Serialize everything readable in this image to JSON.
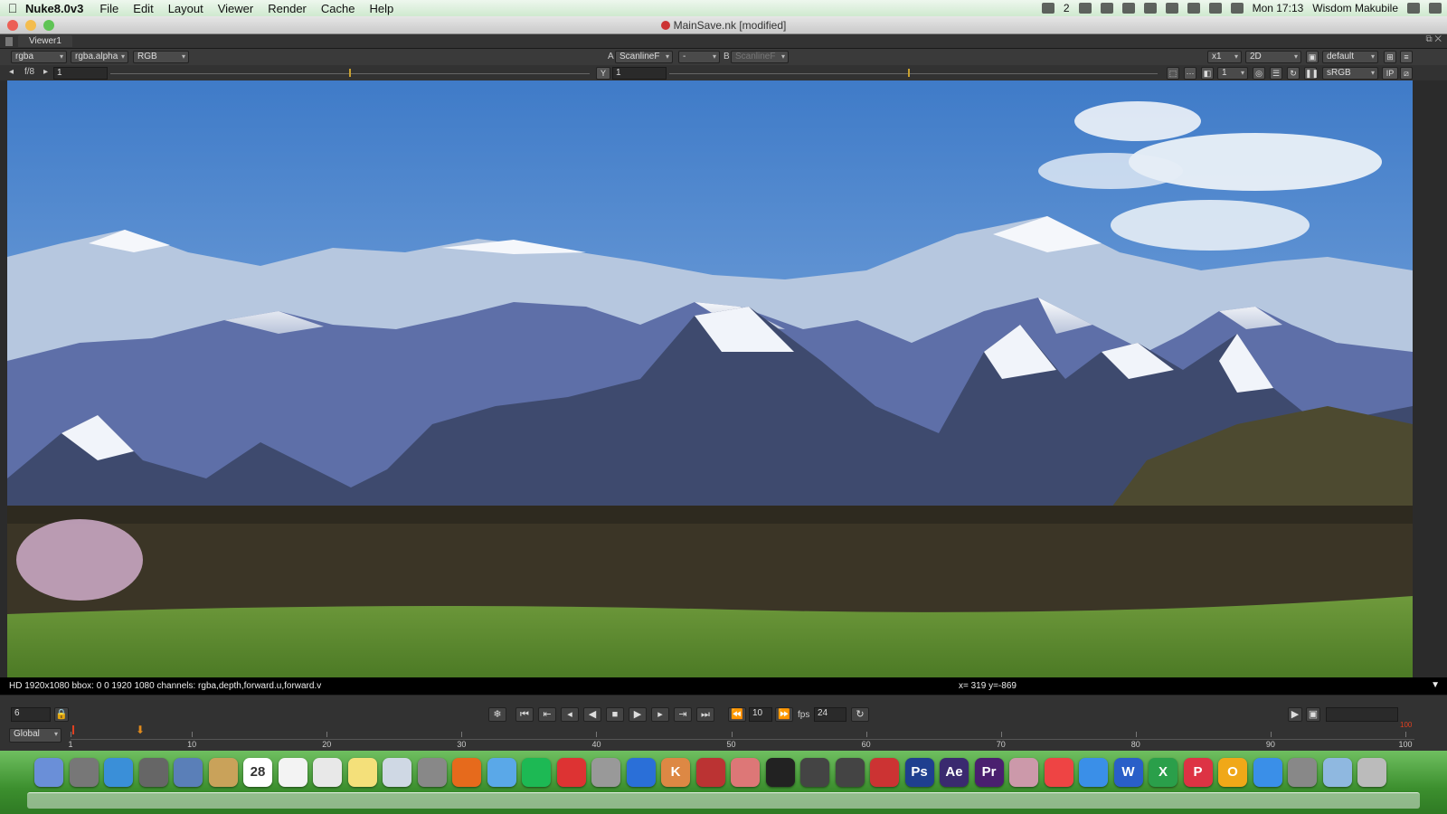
{
  "menubar": {
    "app_name": "Nuke8.0v3",
    "items": [
      "File",
      "Edit",
      "Layout",
      "Viewer",
      "Render",
      "Cache",
      "Help"
    ],
    "status_badge": "2",
    "clock": "Mon 17:13",
    "user": "Wisdom Makubile"
  },
  "window": {
    "title": "MainSave.nk [modified]"
  },
  "viewer": {
    "tab_label": "Viewer1",
    "channels": "rgba",
    "alpha_channel": "rgba.alpha",
    "display_channel": "RGB",
    "input_a_label": "A",
    "input_a": "ScanlineF",
    "wipe_mode": "-",
    "input_b_label": "B",
    "input_b": "ScanlineF",
    "zoom": "x1",
    "view_mode": "2D",
    "lut": "default",
    "fstop": "f/8",
    "gain": "1",
    "gamma_label": "Y",
    "gamma": "1",
    "proxy_value": "1",
    "colorspace": "sRGB",
    "ip_label": "IP"
  },
  "info": {
    "format_text": "HD 1920x1080 bbox: 0 0 1920 1080 channels: rgba,depth,forward.u,forward.v",
    "coords_text": "x= 319 y=-869"
  },
  "playback": {
    "current_frame": "6",
    "skip_frames": "10",
    "fps_label": "fps",
    "fps": "24",
    "range_mode": "Global",
    "tick_labels": [
      "1",
      "10",
      "20",
      "30",
      "40",
      "50",
      "60",
      "70",
      "80",
      "90",
      "100"
    ],
    "end_marker": "100"
  },
  "dock": {
    "calendar_date": "28",
    "icons": [
      "finder-icon",
      "launchpad-icon",
      "safari-icon",
      "photo-browser-icon",
      "preview-icon",
      "contacts-icon",
      "calendar-icon",
      "reminders-icon",
      "textedit-icon",
      "stickies-icon",
      "preview2-icon",
      "facetime-icon",
      "firefox-icon",
      "messages-icon",
      "spotify-icon",
      "downloads-icon",
      "image-capture-icon",
      "bluetooth-icon",
      "keynote-icon",
      "joystick-icon",
      "notes-icon",
      "aperture-icon",
      "nuke-icon",
      "nuke2-icon",
      "davinci-icon",
      "photoshop-icon",
      "aftereffects-icon",
      "premiere-icon",
      "character-icon",
      "acrobat-icon",
      "itunes-icon",
      "word-icon",
      "excel-icon",
      "powerpoint-icon",
      "outlook-icon",
      "appstore-icon",
      "system-prefs-icon",
      "folder-icon",
      "trash-icon"
    ],
    "labels": {
      "ps": "Ps",
      "ae": "Ae",
      "pr": "Pr",
      "kn": "K",
      "w": "W",
      "x": "X",
      "p": "P",
      "o": "O"
    }
  },
  "colors": {
    "viewer_bg": "#2b2b2b",
    "timeline_marker": "#e08a1c",
    "dock_green": "#3c8f2e"
  }
}
